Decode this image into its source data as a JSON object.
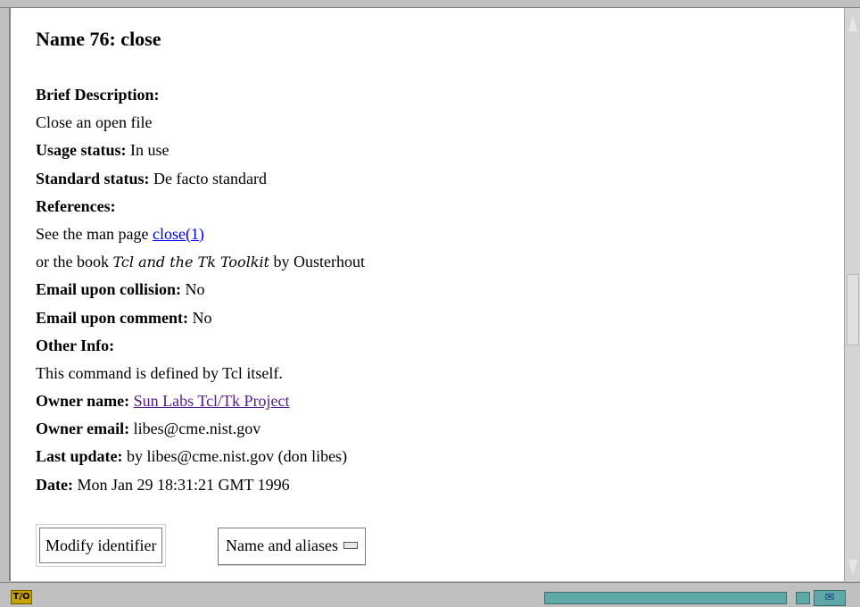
{
  "page": {
    "heading": "Name 76: close"
  },
  "fields": {
    "brief_label": "Brief Description:",
    "brief_value": "Close an open file",
    "usage_label": "Usage status:",
    "usage_value": " In use",
    "standard_label": "Standard status:",
    "standard_value": " De facto standard",
    "references_label": "References:",
    "ref_line1_prefix": "See the man page ",
    "ref_line1_link": "close(1)",
    "ref_line2_prefix": "or the book ",
    "ref_line2_title": "Tcl and the Tk Toolkit",
    "ref_line2_suffix": " by Ousterhout",
    "collision_label": "Email upon collision:",
    "collision_value": " No",
    "comment_label": "Email upon comment:",
    "comment_value": " No",
    "other_label": "Other Info:",
    "other_value": "This command is defined by Tcl itself.",
    "owner_name_label": "Owner name:",
    "owner_name_link": "Sun Labs Tcl/Tk Project",
    "owner_email_label": "Owner email:",
    "owner_email_value": " libes@cme.nist.gov",
    "last_update_label": "Last update:",
    "last_update_value": " by libes@cme.nist.gov (don libes)",
    "date_label": "Date:",
    "date_value": " Mon Jan 29 18:31:21 GMT 1996"
  },
  "buttons": {
    "modify_label": "Modify identifier",
    "names_menu_label": "Name and aliases"
  },
  "status_bar": {
    "logo_text": "T/O"
  },
  "colors": {
    "link": "#0000ee",
    "visited_link": "#551a8b",
    "progress": "#5fa8a8"
  }
}
